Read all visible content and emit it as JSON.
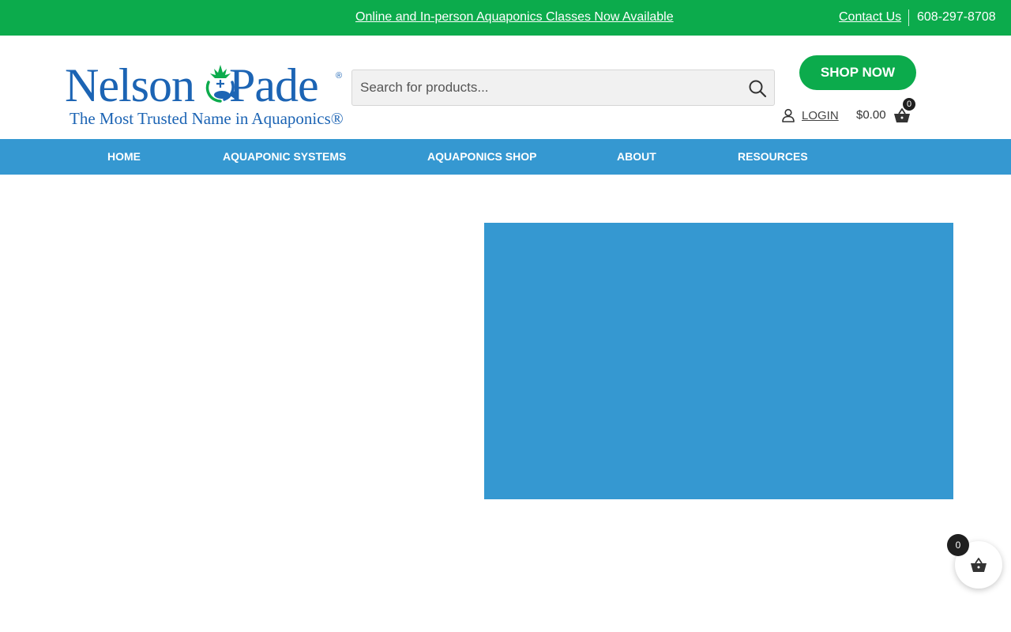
{
  "topbar": {
    "announcement": "Online and In-person Aquaponics Classes Now Available",
    "contact_label": "Contact Us",
    "phone": "608-297-8708"
  },
  "logo": {
    "word_left": "Nelson",
    "word_right": "Pade",
    "registered": "®",
    "tagline": "The Most Trusted Name in Aquaponics®"
  },
  "search": {
    "placeholder": "Search for products..."
  },
  "header": {
    "shop_now_label": "SHOP NOW",
    "login_label": "LOGIN",
    "cart_total": "$0.00",
    "cart_count": "0"
  },
  "nav": {
    "items": [
      {
        "label": "HOME"
      },
      {
        "label": "AQUAPONIC SYSTEMS"
      },
      {
        "label": "AQUAPONICS SHOP"
      },
      {
        "label": "ABOUT"
      },
      {
        "label": "RESOURCES"
      }
    ]
  },
  "floating_cart": {
    "count": "0"
  },
  "colors": {
    "brand_green": "#0cab4c",
    "brand_blue": "#3598d1",
    "logo_blue": "#1c64b4"
  },
  "icons": {
    "search": "search-icon",
    "user": "user-icon",
    "basket": "basket-icon"
  }
}
